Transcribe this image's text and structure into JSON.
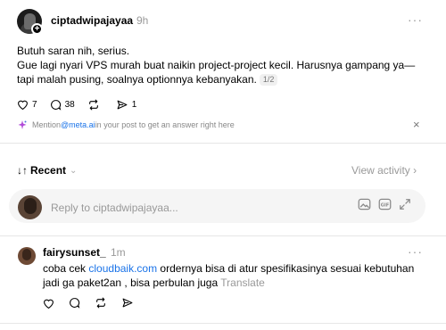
{
  "post": {
    "username": "ciptadwipajayaa",
    "time": "9h",
    "more": "···",
    "follow": "+",
    "lines": [
      "Butuh saran nih, serius.",
      "Gue lagi nyari VPS murah buat naikin project-project kecil. Harusnya gampang ya—tapi malah pusing, soalnya optionnya kebanyakan."
    ],
    "page_badge": "1/2",
    "likes": "7",
    "comments": "38",
    "shares": "1"
  },
  "mention_prompt": {
    "prefix": "Mention ",
    "link": "@meta.ai",
    "suffix": " in your post to get an answer right here",
    "close": "×"
  },
  "sort": {
    "label": "Recent",
    "arrows": "↓↑",
    "chevron": "⌄",
    "view_activity": "View activity ›"
  },
  "reply": {
    "placeholder": "Reply to ciptadwipajayaa..."
  },
  "comment": {
    "username": "fairysunset_",
    "time": "1m",
    "more": "···",
    "text_before": "coba cek ",
    "link": "cloudbaik.com",
    "text_after": " ordernya bisa di atur spesifikasinya sesuai kebutuhan jadi ga paket2an , bisa perbulan juga",
    "translate": "Translate"
  },
  "icons": {
    "heart": "heart-icon",
    "comment": "comment-icon",
    "repost": "repost-icon",
    "share": "send-icon",
    "sparkle": "sparkle-icon",
    "image": "image-icon",
    "gif": "gif-icon",
    "expand": "expand-icon"
  },
  "colors": {
    "link": "#1a73e8",
    "muted": "#999999",
    "divider": "#e6e6e6",
    "reply_bg": "#f5f5f5"
  }
}
